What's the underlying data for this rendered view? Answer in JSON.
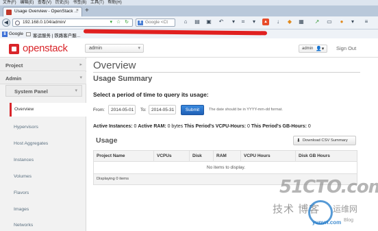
{
  "browser": {
    "menu": [
      "文件(F)",
      "编辑(E)",
      "查看(V)",
      "历史(S)",
      "书签(B)",
      "工具(T)",
      "帮助(H)"
    ],
    "tab_title": "Usage Overview - OpenStack ...",
    "tab_close": "×",
    "new_tab": "+",
    "url": "192.168.0.104/admin/",
    "search_placeholder": "Google <Ct",
    "bookmarks": [
      {
        "label": "Google"
      },
      {
        "label": "客运服务 | 铁路客户服..."
      }
    ]
  },
  "header": {
    "logo_text": "openstack",
    "project_select": "admin",
    "user_name": "admin",
    "signout": "Sign Out"
  },
  "sidebar": {
    "project_label": "Project",
    "admin_label": "Admin",
    "panel_label": "System Panel",
    "items": [
      {
        "label": "Overview",
        "active": true
      },
      {
        "label": "Hypervisors"
      },
      {
        "label": "Host Aggregates"
      },
      {
        "label": "Instances"
      },
      {
        "label": "Volumes"
      },
      {
        "label": "Flavors"
      },
      {
        "label": "Images"
      },
      {
        "label": "Networks"
      }
    ]
  },
  "main": {
    "page_title": "Overview",
    "section_title": "Usage Summary",
    "question": "Select a period of time to query its usage:",
    "from_label": "From:",
    "from_value": "2014-05-01",
    "to_label": "To:",
    "to_value": "2014-05-31",
    "submit": "Submit",
    "date_hint": "The date should be in YYYY-mm-dd format.",
    "stats": {
      "instances_label": "Active Instances:",
      "instances_value": "0",
      "ram_label": "Active RAM:",
      "ram_value": "0 bytes",
      "vcpu_label": "This Period's VCPU-Hours:",
      "vcpu_value": "0",
      "gb_label": "This Period's GB-Hours:",
      "gb_value": "0"
    },
    "usage_title": "Usage",
    "csv_button": "Download CSV Summary",
    "table": {
      "columns": [
        "Project Name",
        "VCPUs",
        "Disk",
        "RAM",
        "VCPU Hours",
        "Disk GB Hours"
      ],
      "empty": "No items to display.",
      "footer": "Displaying 0 items"
    }
  },
  "watermark": {
    "big": "51CTO.com",
    "cn": "技术 博客",
    "circle": "运维网",
    "domain": "yunvn.com",
    "blog": "Blog"
  },
  "colors": {
    "brand_red": "#d9252a",
    "submit_blue": "#1f5fb5",
    "redaction": "#e02020"
  }
}
